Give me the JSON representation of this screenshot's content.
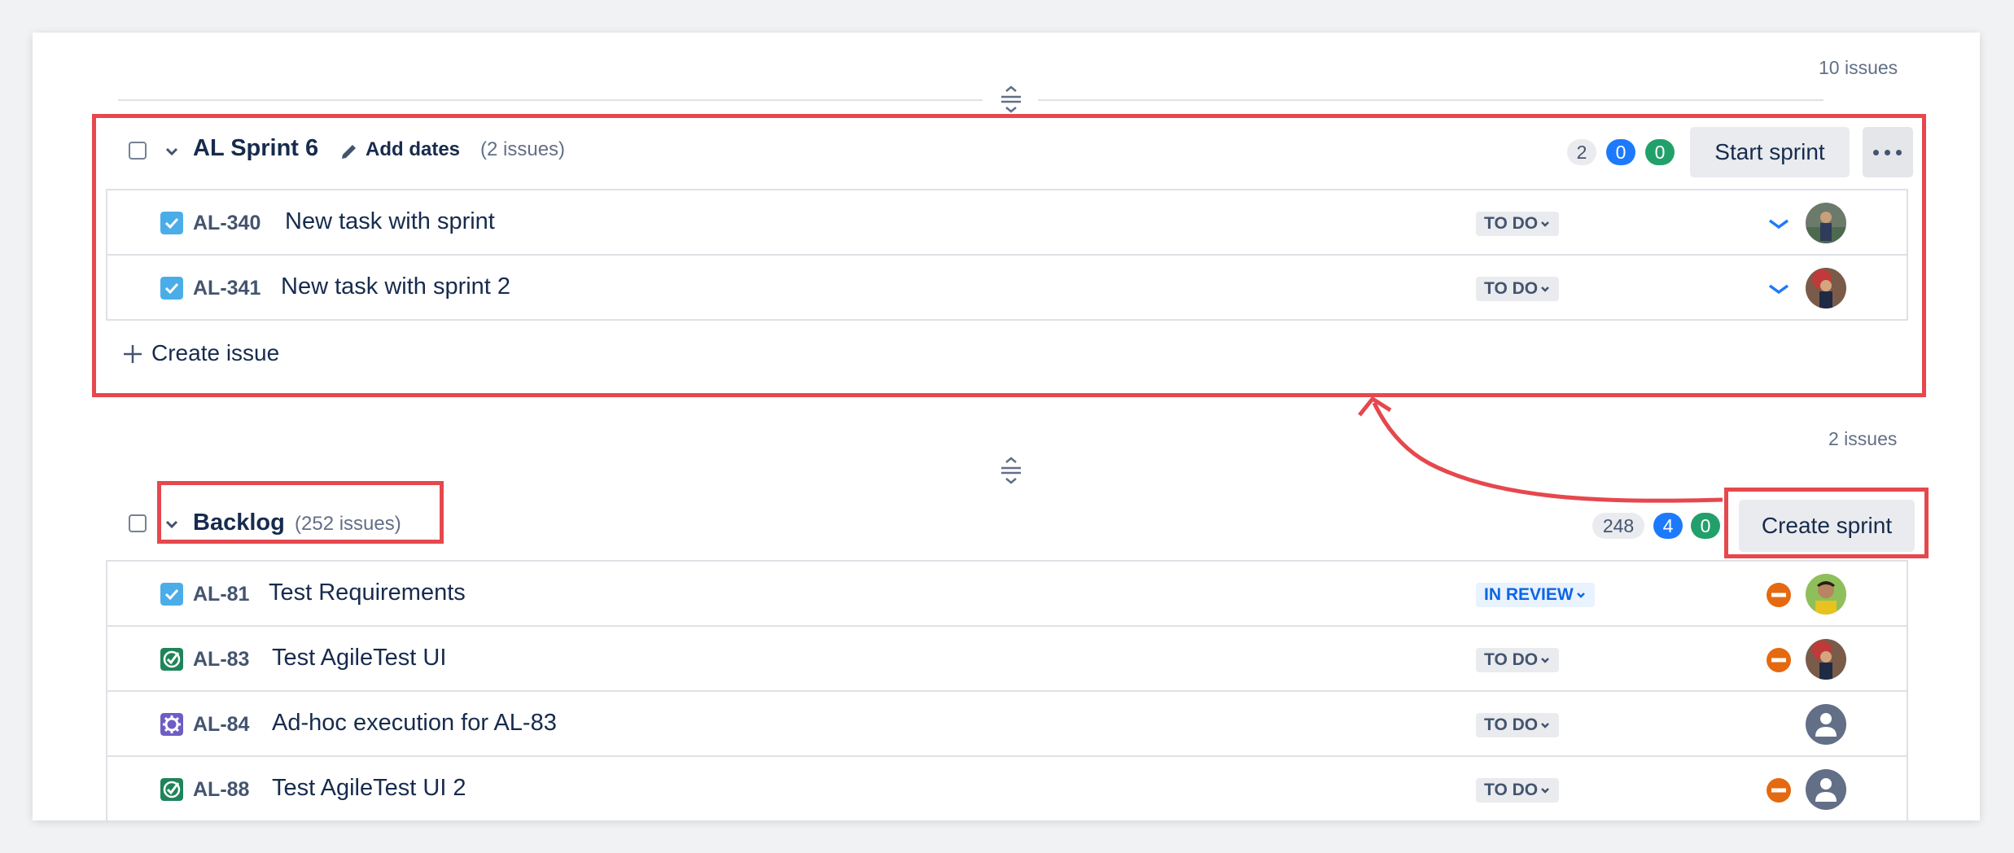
{
  "top": {
    "issue_count": "10 issues"
  },
  "sprint": {
    "name": "AL Sprint 6",
    "add_dates": "Add dates",
    "issue_count": "(2 issues)",
    "badges": {
      "todo": "2",
      "in_progress": "0",
      "done": "0"
    },
    "start_button": "Start sprint",
    "create_issue": "Create issue",
    "issues": [
      {
        "key": "AL-340",
        "summary": "New task with sprint",
        "status": "TO DO",
        "priority": "low",
        "type": "task"
      },
      {
        "key": "AL-341",
        "summary": "New task with sprint 2",
        "status": "TO DO",
        "priority": "low",
        "type": "task"
      }
    ]
  },
  "middle": {
    "issue_count": "2 issues"
  },
  "backlog": {
    "name": "Backlog",
    "issue_count": "(252 issues)",
    "badges": {
      "todo": "248",
      "in_progress": "4",
      "done": "0"
    },
    "create_sprint_button": "Create sprint",
    "issues": [
      {
        "key": "AL-81",
        "summary": "Test Requirements",
        "status": "IN REVIEW",
        "priority": "blocker",
        "type": "task"
      },
      {
        "key": "AL-83",
        "summary": "Test AgileTest UI",
        "status": "TO DO",
        "priority": "blocker",
        "type": "test"
      },
      {
        "key": "AL-84",
        "summary": "Ad-hoc execution for AL-83",
        "status": "TO DO",
        "priority": "none",
        "type": "execution"
      },
      {
        "key": "AL-88",
        "summary": "Test AgileTest UI 2",
        "status": "TO DO",
        "priority": "blocker",
        "type": "test"
      }
    ]
  },
  "colors": {
    "accent": "#e5484d",
    "blue_badge": "#1d7afc",
    "green_badge": "#22a06b",
    "task_icon": "#4bade8",
    "test_icon": "#22a06b",
    "execution_icon": "#6e5dc6"
  },
  "icons": [
    "drag-handle-icon",
    "chevron-down-icon",
    "pencil-icon",
    "checkbox-task-icon",
    "test-check-icon",
    "gear-execution-icon",
    "priority-low-icon",
    "priority-blocker-icon",
    "more-icon",
    "plus-icon",
    "annotation-arrow"
  ]
}
